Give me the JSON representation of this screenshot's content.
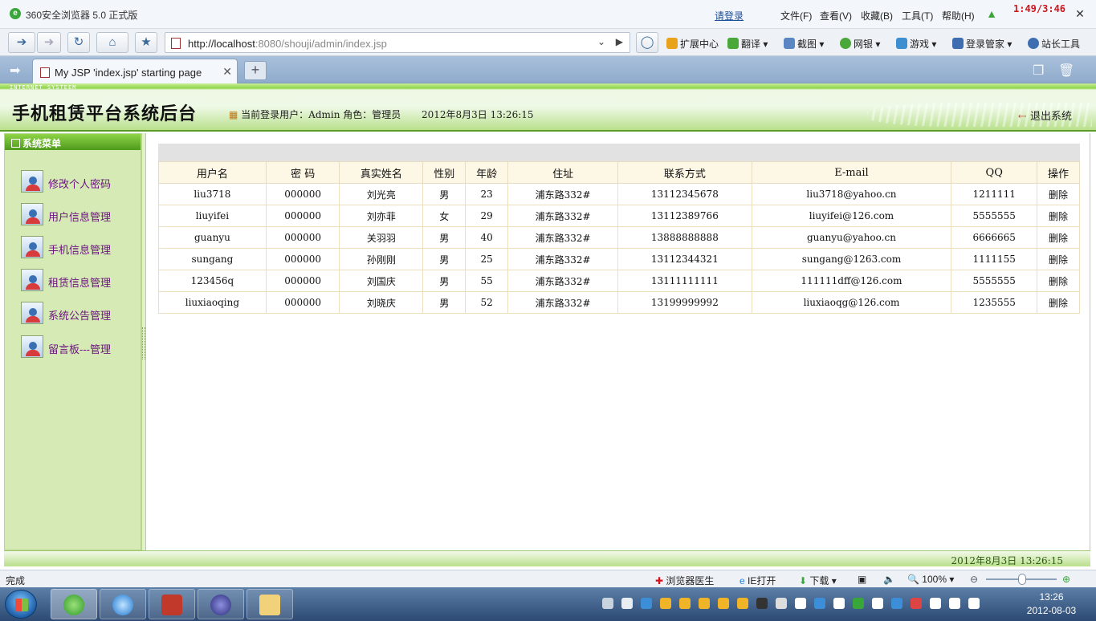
{
  "browser": {
    "app_title": "360安全浏览器 5.0 正式版",
    "login_link": "请登录",
    "menus": [
      "文件(F)",
      "查看(V)",
      "收藏(B)",
      "工具(T)",
      "帮助(H)"
    ],
    "overlay_clock": "1:49/3:46",
    "url_host": "http://localhost",
    "url_rest": ":8080/shouji/admin/index.jsp",
    "tools": [
      "扩展中心",
      "翻译",
      "截图",
      "网银",
      "游戏",
      "登录管家",
      "站长工具"
    ],
    "tab_title": "My JSP 'index.jsp' starting page"
  },
  "header": {
    "system_caption": "INTERNET SYSTEEM",
    "brand": "手机租赁平台系统后台",
    "current_user": "当前登录用户：Admin 角色：管理员",
    "datetime": "2012年8月3日  13:26:15",
    "logout": "退出系统"
  },
  "sidebar": {
    "title": "系统菜单",
    "items": [
      "修改个人密码",
      "用户信息管理",
      "手机信息管理",
      "租赁信息管理",
      "系统公告管理",
      "留言板---管理"
    ]
  },
  "table": {
    "headers": [
      "用户名",
      "密 码",
      "真实姓名",
      "性别",
      "年龄",
      "住址",
      "联系方式",
      "E-mail",
      "QQ",
      "操作"
    ],
    "rows": [
      [
        "liu3718",
        "000000",
        "刘光亮",
        "男",
        "23",
        "浦东路332#",
        "13112345678",
        "liu3718@yahoo.cn",
        "1211111",
        "删除"
      ],
      [
        "liuyifei",
        "000000",
        "刘亦菲",
        "女",
        "29",
        "浦东路332#",
        "13112389766",
        "liuyifei@126.com",
        "5555555",
        "删除"
      ],
      [
        "guanyu",
        "000000",
        "关羽羽",
        "男",
        "40",
        "浦东路332#",
        "13888888888",
        "guanyu@yahoo.cn",
        "6666665",
        "删除"
      ],
      [
        "sungang",
        "000000",
        "孙刚刚",
        "男",
        "25",
        "浦东路332#",
        "13112344321",
        "sungang@1263.com",
        "1111155",
        "删除"
      ],
      [
        "123456q",
        "000000",
        "刘国庆",
        "男",
        "55",
        "浦东路332#",
        "13111111111",
        "111111dff@126.com",
        "5555555",
        "删除"
      ],
      [
        "liuxiaoqing",
        "000000",
        "刘晓庆",
        "男",
        "52",
        "浦东路332#",
        "13199999992",
        "liuxiaoqg@126.com",
        "1235555",
        "删除"
      ]
    ]
  },
  "footer": {
    "datetime": "2012年8月3日  13:26:15"
  },
  "statusbar": {
    "status": "完成",
    "doctor": "浏览器医生",
    "ie_open": "IE打开",
    "download": "下载",
    "zoom": "100%"
  },
  "taskbar": {
    "time": "13:26",
    "date": "2012-08-03"
  },
  "colors": {
    "accent_green": "#5a9b25",
    "sidebar_bg": "#d5eab5",
    "link_purple": "#6b137f",
    "table_header_bg": "#fdf7e6"
  }
}
